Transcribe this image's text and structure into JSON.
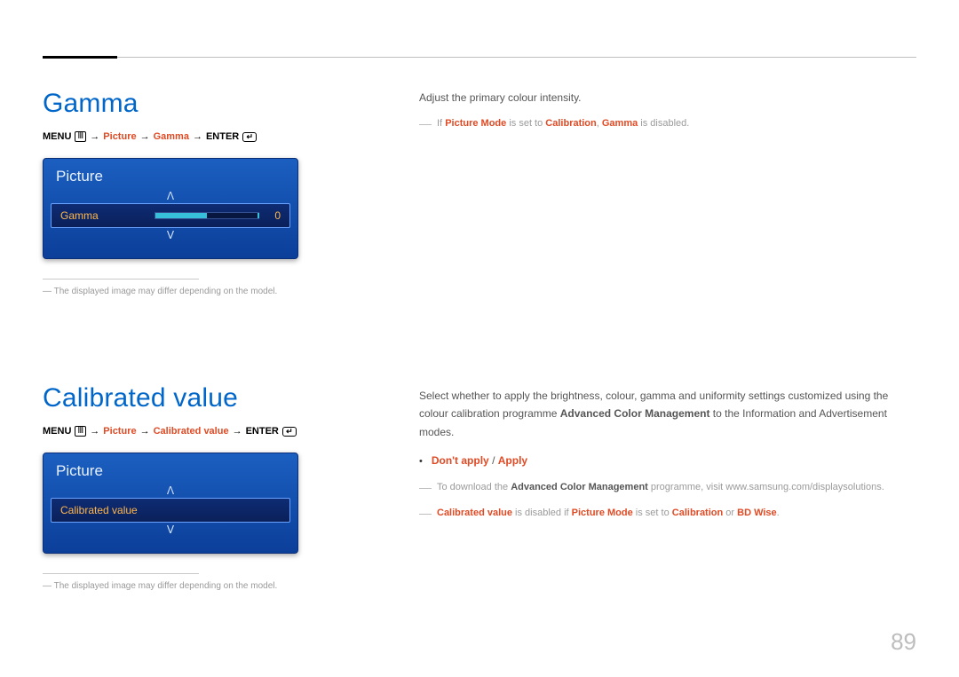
{
  "page_number": "89",
  "section1": {
    "title": "Gamma",
    "menu_path": {
      "menu_label": "MENU",
      "picture": "Picture",
      "item": "Gamma",
      "enter_label": "ENTER",
      "arrow": "→"
    },
    "osd": {
      "title": "Picture",
      "up": "ᐱ",
      "down": "ᐯ",
      "row_label": "Gamma",
      "row_value": "0"
    },
    "note": "The displayed image may differ depending on the model.",
    "right": {
      "para": "Adjust the primary colour intensity.",
      "dash_prefix": "If",
      "dash_p1": "Picture Mode",
      "dash_mid": "is set to",
      "dash_p2": "Calibration",
      "dash_comma": ",",
      "dash_p3": "Gamma",
      "dash_suffix": "is disabled."
    }
  },
  "section2": {
    "title": "Calibrated value",
    "menu_path": {
      "menu_label": "MENU",
      "picture": "Picture",
      "item": "Calibrated value",
      "enter_label": "ENTER",
      "arrow": "→"
    },
    "osd": {
      "title": "Picture",
      "up": "ᐱ",
      "down": "ᐯ",
      "row_label": "Calibrated value"
    },
    "note": "The displayed image may differ depending on the model.",
    "right": {
      "para_a": "Select whether to apply the brightness, colour, gamma and uniformity settings customized using the colour calibration programme",
      "para_strong": "Advanced Color Management",
      "para_b": "to the Information and Advertisement modes.",
      "bullet_a": "Don't apply",
      "bullet_sep": "/",
      "bullet_b": "Apply",
      "dash1_a": "To download the",
      "dash1_strong": "Advanced Color Management",
      "dash1_b": "programme, visit www.samsung.com/displaysolutions.",
      "dash2_a": "Calibrated value",
      "dash2_b": "is disabled if",
      "dash2_c": "Picture Mode",
      "dash2_d": "is set to",
      "dash2_e": "Calibration",
      "dash2_or": "or",
      "dash2_f": "BD Wise",
      "dash2_end": "."
    }
  }
}
